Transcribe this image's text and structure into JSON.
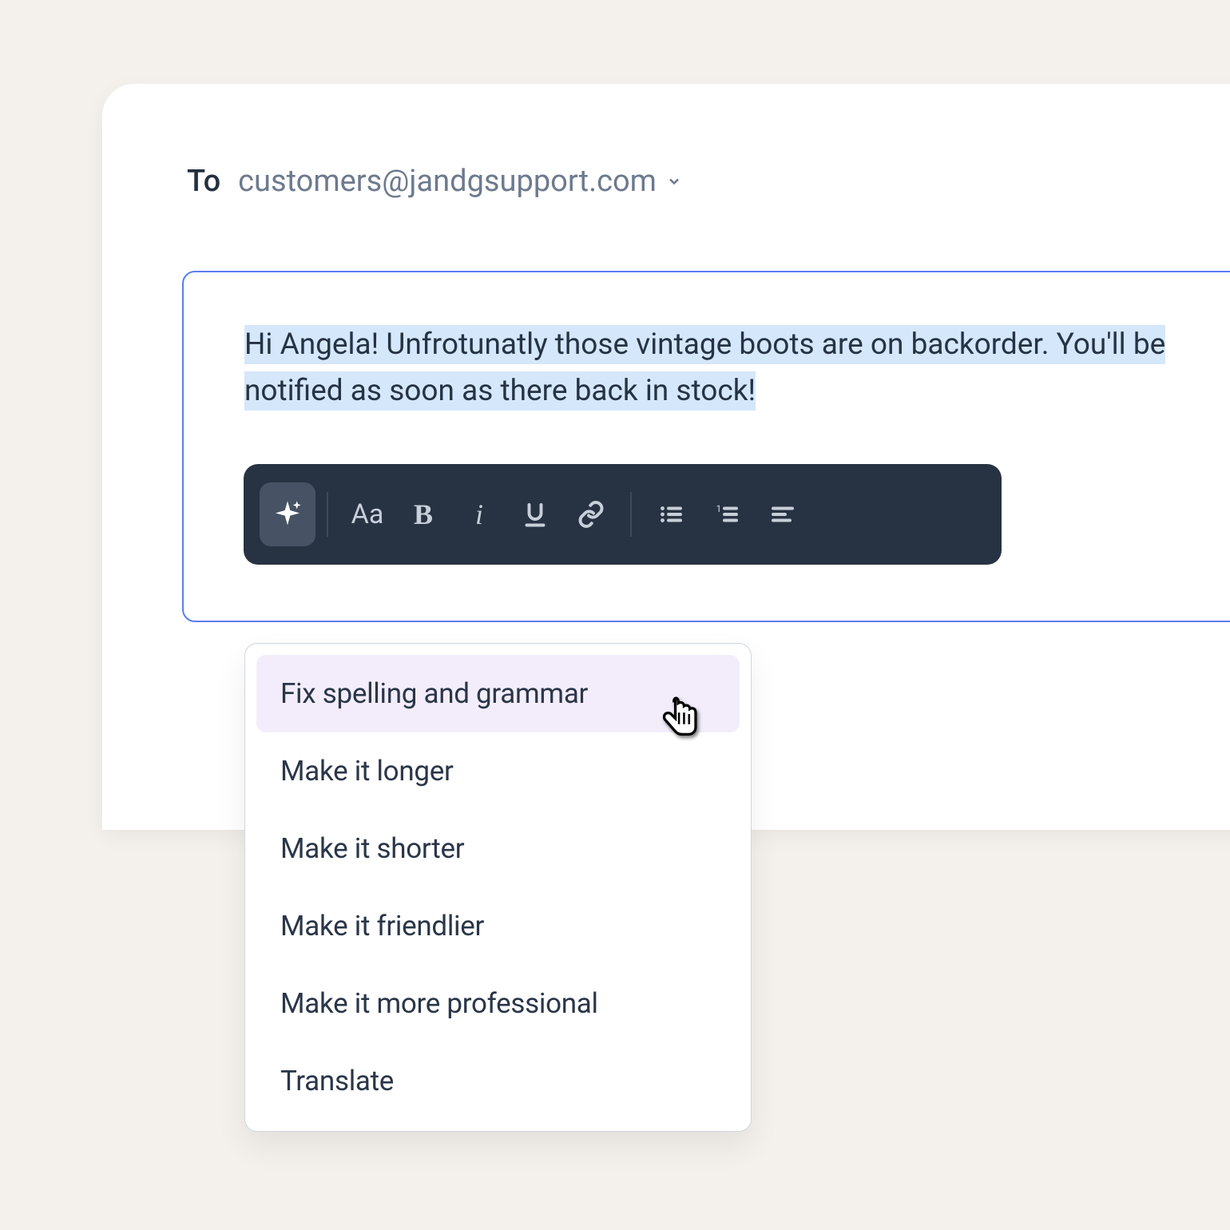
{
  "header": {
    "to_label": "To",
    "address": "customers@jandgsupport.com"
  },
  "compose": {
    "selected_text": "Hi Angela! Unfrotunatly those vintage boots are on backorder.  You'll be notified as soon as there back in stock!"
  },
  "toolbar": {
    "icons": {
      "sparkle": "ai-sparkle",
      "font": "Aa",
      "bold": "B",
      "italic": "i",
      "underline": "U",
      "link": "link",
      "bullets": "bulleted-list",
      "numbered": "numbered-list",
      "align": "align-left"
    }
  },
  "ai_menu": {
    "items": [
      "Fix spelling and grammar",
      "Make it longer",
      "Make it shorter",
      "Make it friendlier",
      "Make it more professional",
      "Translate"
    ]
  },
  "colors": {
    "selection": "#d5e7fa",
    "focus_border": "#5a7df0",
    "toolbar_bg": "#273342",
    "menu_hover": "#f3edfb"
  }
}
